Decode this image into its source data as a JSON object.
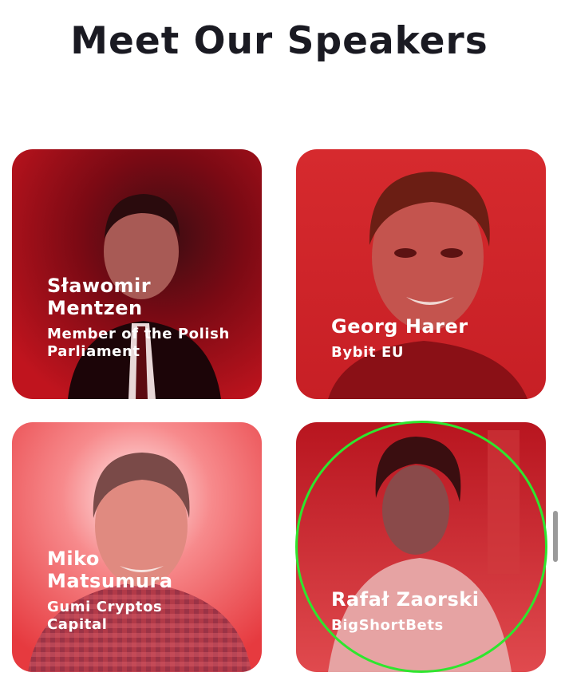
{
  "section": {
    "title": "Meet Our Speakers"
  },
  "speakers": [
    {
      "name": "Sławomir Mentzen",
      "role": "Member of the Polish Parliament"
    },
    {
      "name": "Georg Harer",
      "role": "Bybit EU"
    },
    {
      "name": "Miko Matsumura",
      "role": "Gumi Cryptos Capital"
    },
    {
      "name": "Rafał Zaorski",
      "role": "BigShortBets"
    }
  ],
  "colors": {
    "accent": "#d81f26",
    "card_dark": "#7a0610",
    "highlight": "#2ee62e"
  }
}
